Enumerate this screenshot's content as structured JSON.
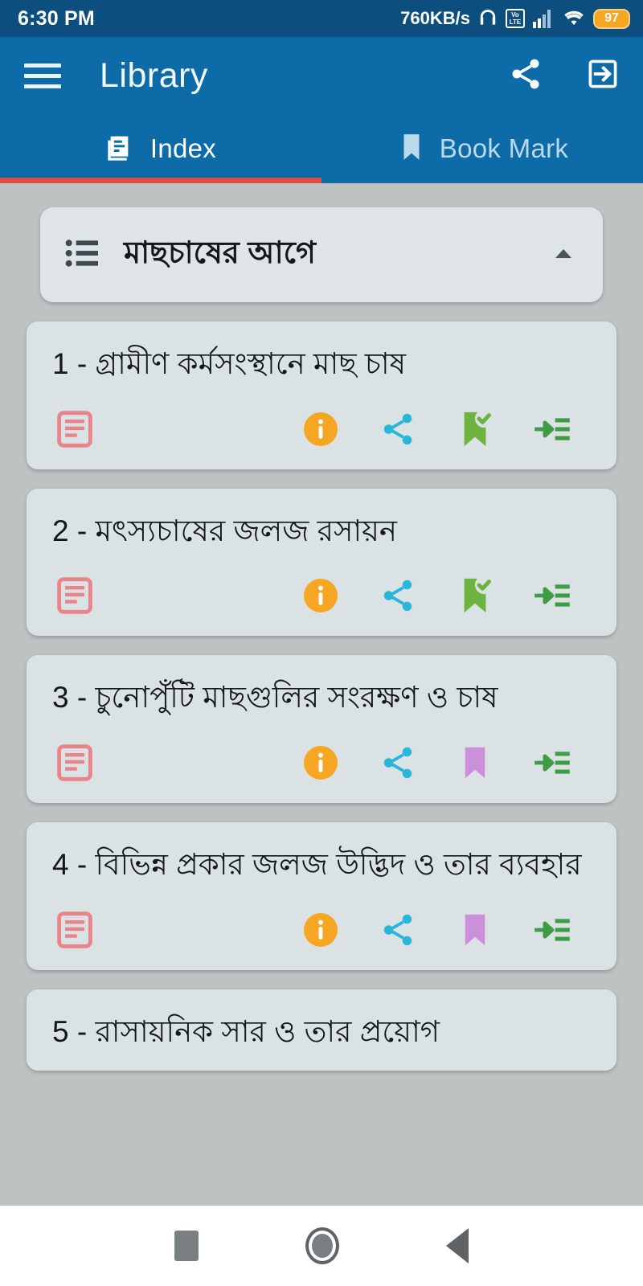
{
  "status_bar": {
    "time": "6:30 PM",
    "network_speed": "760KB/s",
    "volte_top": "Vo",
    "volte_bottom": "LTE",
    "battery_percent": "97",
    "icons": [
      "headphone-icon",
      "volte-icon",
      "signal-bars-icon",
      "wifi-icon",
      "battery-icon"
    ]
  },
  "app_bar": {
    "title": "Library",
    "menu_icon": "hamburger-menu-icon",
    "share_icon": "share-icon",
    "exit_icon": "exit-icon"
  },
  "tabs": {
    "active_index": 0,
    "indicator_color": "#e04a3f",
    "items": [
      {
        "label": "Index",
        "icon": "book-pages-icon",
        "active": true
      },
      {
        "label": "Book Mark",
        "icon": "bookmark-icon",
        "active": false
      }
    ]
  },
  "section": {
    "title": "মাছচাষের আগে",
    "list_icon": "bulleted-list-icon",
    "collapse_icon": "chevron-up-icon",
    "expanded": true
  },
  "colors": {
    "app_bar": "#0d6ba8",
    "status_bar": "#0c4f7e",
    "page_background": "#bfc2c2",
    "card": "#dbe2e4",
    "doc_icon": "#e8848a",
    "info_icon": "#f5a623",
    "share_icon": "#29b6d8",
    "bookmark_saved": "#6cb33f",
    "bookmark_unsaved": "#cc8fdb",
    "list_add_icon": "#3f9b44"
  },
  "items": [
    {
      "number": "1",
      "title": "1 - গ্রামীণ কর্মসংস্থানে মাছ চাষ",
      "bookmarked": true,
      "actions": [
        "article-icon",
        "info-icon",
        "share-icon",
        "bookmark-check-icon",
        "add-to-list-icon"
      ]
    },
    {
      "number": "2",
      "title": "2 - মৎস্যচাষের জলজ রসায়ন",
      "bookmarked": true,
      "actions": [
        "article-icon",
        "info-icon",
        "share-icon",
        "bookmark-check-icon",
        "add-to-list-icon"
      ]
    },
    {
      "number": "3",
      "title": "3 - চুনোপুঁটি মাছগুলির সংরক্ষণ ও চাষ",
      "bookmarked": false,
      "actions": [
        "article-icon",
        "info-icon",
        "share-icon",
        "bookmark-icon",
        "add-to-list-icon"
      ]
    },
    {
      "number": "4",
      "title": "4 - বিভিন্ন প্রকার জলজ উদ্ভিদ ও তার ব্যবহার",
      "bookmarked": false,
      "actions": [
        "article-icon",
        "info-icon",
        "share-icon",
        "bookmark-icon",
        "add-to-list-icon"
      ]
    },
    {
      "number": "5",
      "title": "5 - রাসায়নিক সার ও তার প্রয়োগ",
      "bookmarked": false,
      "actions": []
    }
  ],
  "nav_bar": {
    "recents_icon": "square-recents-icon",
    "home_icon": "circle-home-icon",
    "back_icon": "triangle-back-icon"
  }
}
